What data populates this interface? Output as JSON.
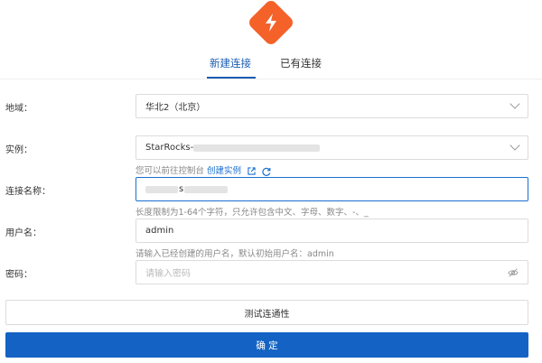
{
  "tabs": {
    "new_connection": "新建连接",
    "existing_connection": "已有连接"
  },
  "form": {
    "region": {
      "label": "地域：",
      "value": "华北2（北京）"
    },
    "instance": {
      "label": "实例：",
      "value_prefix": "StarRocks-",
      "hint_text": "您可以前往控制台",
      "hint_link": "创建实例"
    },
    "connection_name": {
      "label": "连接名称：",
      "value_visible_char": "s",
      "hint": "长度限制为1-64个字符，只允许包含中文、字母、数字、-、_"
    },
    "username": {
      "label": "用户名：",
      "value": "admin",
      "hint": "请输入已经创建的用户名，默认初始用户名：admin"
    },
    "password": {
      "label": "密码：",
      "placeholder": "请输入密码"
    }
  },
  "buttons": {
    "test": "测试连通性",
    "confirm": "确 定"
  },
  "colors": {
    "brand": "#f4622a",
    "accent": "#1a5cb0",
    "primary_button": "#1463c4"
  },
  "icons": {
    "logo": "brand-logo-icon",
    "external_link": "external-link-icon",
    "refresh": "refresh-icon",
    "password_visibility": "eye-off-icon",
    "dropdown": "chevron-down-icon"
  }
}
